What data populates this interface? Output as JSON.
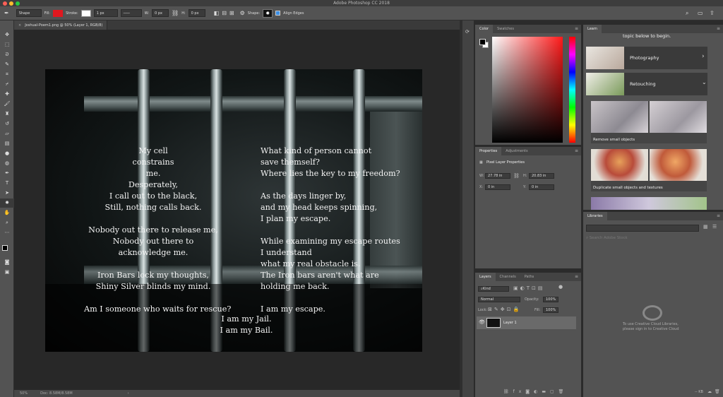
{
  "window": {
    "title": "Adobe Photoshop CC 2018"
  },
  "options_bar": {
    "mode": "Shape",
    "fill_label": "Fill:",
    "fill_color": "#e0181f",
    "stroke_label": "Stroke:",
    "stroke_width": "1 px",
    "w_label": "W:",
    "w_value": "0 px",
    "h_label": "H:",
    "h_value": "0 px",
    "shape_label": "Shape:",
    "align_edges": "Align Edges"
  },
  "document": {
    "tab": "Joshual-Poem1.png @ 50% (Layer 1, RGB/8)",
    "poem_left": [
      "My cell",
      "constrains",
      "me.",
      "Desperately,",
      "I call out to the black,",
      "Still, nothing calls back.",
      "",
      "Nobody out there to release me,",
      "Nobody out there to",
      "acknowledge me.",
      "",
      "Iron Bars lock my thoughts,",
      "Shiny Silver blinds my mind.",
      "",
      "Am I someone who waits for rescue?"
    ],
    "poem_right": [
      "What kind of person cannot",
      "save themself?",
      "Where lies the key to my freedom?",
      "",
      "As the days linger by,",
      "and my head keeps spinning,",
      "I plan my escape.",
      "",
      "While examining my escape routes",
      "I understand",
      "what my real obstacle is.",
      "The Iron bars aren't what are",
      "holding me back.",
      "",
      "I am my escape."
    ],
    "poem_bottom": [
      "I am my Jail.",
      "I am my Bail."
    ]
  },
  "status": {
    "zoom": "50%",
    "doc": "Doc: 8.58M/8.58M"
  },
  "color_panel": {
    "tabs": [
      "Color",
      "Swatches"
    ],
    "hue_color": "#ff1a1a"
  },
  "properties_panel": {
    "tabs": [
      "Properties",
      "Adjustments"
    ],
    "header": "Pixel Layer Properties",
    "w_label": "W:",
    "w_value": "27.78 in",
    "h_label": "H:",
    "h_value": "20.83 in",
    "x_label": "X:",
    "x_value": "0 in",
    "y_label": "Y:",
    "y_value": "0 in"
  },
  "layers_panel": {
    "tabs": [
      "Layers",
      "Channels",
      "Paths"
    ],
    "kind": "Kind",
    "blend": "Normal",
    "opacity_label": "Opacity:",
    "opacity": "100%",
    "lock_label": "Lock:",
    "fill_label": "Fill:",
    "fill": "100%",
    "layer_name": "Layer 1"
  },
  "learn_panel": {
    "tab": "Learn",
    "intro": "topic below to begin.",
    "cat_photography": "Photography",
    "cat_retouching": "Retouching",
    "tutorial_1": "Remove small objects",
    "tutorial_2": "Duplicate small objects and textures"
  },
  "libraries_panel": {
    "tab": "Libraries",
    "search_placeholder": "Search Adobe Stock",
    "message_1": "To use Creative Cloud Libraries,",
    "message_2": "please sign in to Creative Cloud",
    "size": "-- KB"
  }
}
